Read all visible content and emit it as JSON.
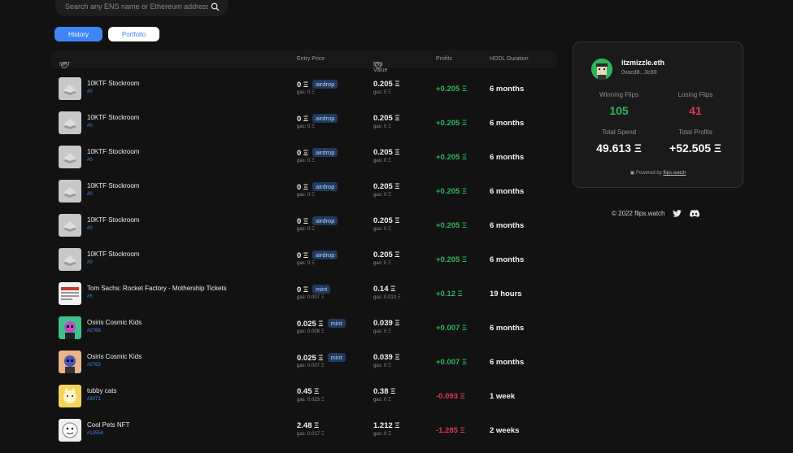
{
  "search": {
    "placeholder": "Search any ENS name or Ethereum address"
  },
  "tabs": [
    {
      "label": "History",
      "active": true
    },
    {
      "label": "Portfolio",
      "active": false
    }
  ],
  "table": {
    "headers": {
      "nft": "NFT",
      "entry": "Entry Price",
      "exit": "Exit Value",
      "profits": "Profits",
      "hodl": "HODL Duration"
    },
    "rows": [
      {
        "name": "10KTF Stockroom",
        "id": "#0",
        "entry": "0 Ξ",
        "badge": "airdrop",
        "entry_gas": "gas: 0 Ξ",
        "exit": "0.205 Ξ",
        "exit_gas": "gas: 0 Ξ",
        "profit": "+0.205 Ξ",
        "profit_sign": "pos",
        "hodl": "6 months",
        "thumb": "stockroom"
      },
      {
        "name": "10KTF Stockroom",
        "id": "#0",
        "entry": "0 Ξ",
        "badge": "airdrop",
        "entry_gas": "gas: 0 Ξ",
        "exit": "0.205 Ξ",
        "exit_gas": "gas: 0 Ξ",
        "profit": "+0.205 Ξ",
        "profit_sign": "pos",
        "hodl": "6 months",
        "thumb": "stockroom"
      },
      {
        "name": "10KTF Stockroom",
        "id": "#0",
        "entry": "0 Ξ",
        "badge": "airdrop",
        "entry_gas": "gas: 0 Ξ",
        "exit": "0.205 Ξ",
        "exit_gas": "gas: 0 Ξ",
        "profit": "+0.205 Ξ",
        "profit_sign": "pos",
        "hodl": "6 months",
        "thumb": "stockroom"
      },
      {
        "name": "10KTF Stockroom",
        "id": "#0",
        "entry": "0 Ξ",
        "badge": "airdrop",
        "entry_gas": "gas: 0 Ξ",
        "exit": "0.205 Ξ",
        "exit_gas": "gas: 0 Ξ",
        "profit": "+0.205 Ξ",
        "profit_sign": "pos",
        "hodl": "6 months",
        "thumb": "stockroom"
      },
      {
        "name": "10KTF Stockroom",
        "id": "#0",
        "entry": "0 Ξ",
        "badge": "airdrop",
        "entry_gas": "gas: 0 Ξ",
        "exit": "0.205 Ξ",
        "exit_gas": "gas: 0 Ξ",
        "profit": "+0.205 Ξ",
        "profit_sign": "pos",
        "hodl": "6 months",
        "thumb": "stockroom"
      },
      {
        "name": "10KTF Stockroom",
        "id": "#0",
        "entry": "0 Ξ",
        "badge": "airdrop",
        "entry_gas": "gas: 0 Ξ",
        "exit": "0.205 Ξ",
        "exit_gas": "gas: 0 Ξ",
        "profit": "+0.205 Ξ",
        "profit_sign": "pos",
        "hodl": "6 months",
        "thumb": "stockroom"
      },
      {
        "name": "Tom Sachs: Rocket Factory - Mothership Tickets",
        "id": "#5",
        "entry": "0 Ξ",
        "badge": "mint",
        "entry_gas": "gas: 0.007 Ξ",
        "exit": "0.14 Ξ",
        "exit_gas": "gas: 0.013 Ξ",
        "profit": "+0.12 Ξ",
        "profit_sign": "pos",
        "hodl": "19 hours",
        "thumb": "ticket"
      },
      {
        "name": "Osiris Cosmic Kids",
        "id": "#2768",
        "entry": "0.025 Ξ",
        "badge": "mint",
        "entry_gas": "gas: 0.008 Ξ",
        "exit": "0.039 Ξ",
        "exit_gas": "gas: 0 Ξ",
        "profit": "+0.007 Ξ",
        "profit_sign": "pos",
        "hodl": "6 months",
        "thumb": "osiris1"
      },
      {
        "name": "Osiris Cosmic Kids",
        "id": "#2763",
        "entry": "0.025 Ξ",
        "badge": "mint",
        "entry_gas": "gas: 0.007 Ξ",
        "exit": "0.039 Ξ",
        "exit_gas": "gas: 0 Ξ",
        "profit": "+0.007 Ξ",
        "profit_sign": "pos",
        "hodl": "6 months",
        "thumb": "osiris2"
      },
      {
        "name": "tubby cats",
        "id": "#3071",
        "entry": "0.45 Ξ",
        "badge": "",
        "entry_gas": "gas: 0.023 Ξ",
        "exit": "0.38 Ξ",
        "exit_gas": "gas: 0 Ξ",
        "profit": "-0.093 Ξ",
        "profit_sign": "neg",
        "hodl": "1 week",
        "thumb": "tubby"
      },
      {
        "name": "Cool Pets NFT",
        "id": "#13554",
        "entry": "2.48 Ξ",
        "badge": "",
        "entry_gas": "gas: 0.017 Ξ",
        "exit": "1.212 Ξ",
        "exit_gas": "gas: 0 Ξ",
        "profit": "-1.285 Ξ",
        "profit_sign": "neg",
        "hodl": "2 weeks",
        "thumb": "pets"
      }
    ]
  },
  "profile": {
    "name": "itzmizzle.eth",
    "address": "0xacd8...3c88",
    "winning_label": "Winning Flips",
    "winning_value": "105",
    "losing_label": "Losing Flips",
    "losing_value": "41",
    "spend_label": "Total Spend",
    "spend_value": "49.613 Ξ",
    "profits_label": "Total Profits",
    "profits_value": "+52.505 Ξ",
    "powered_prefix": "Powered by",
    "powered_link": "flips.watch"
  },
  "footer": {
    "copyright": "© 2022 flips.watch"
  },
  "colors": {
    "accent": "#3e86f5",
    "positive": "#2fb55c",
    "negative": "#e0384a",
    "background": "#121212"
  }
}
